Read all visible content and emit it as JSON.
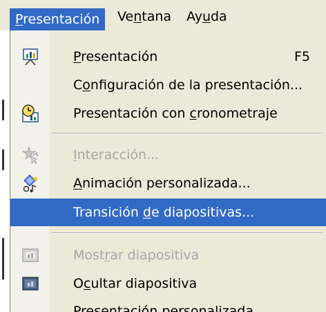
{
  "menubar": {
    "items": [
      {
        "pre": "",
        "u": "P",
        "post": "resentación"
      },
      {
        "pre": "Ve",
        "u": "n",
        "post": "tana"
      },
      {
        "pre": "Ay",
        "u": "u",
        "post": "da"
      }
    ]
  },
  "menu": {
    "items": [
      {
        "pre": "",
        "u": "P",
        "post": "resentación",
        "shortcut": "F5",
        "icon": "slideshow-screen-icon"
      },
      {
        "pre": "C",
        "u": "o",
        "post": "nfiguración de la presentación..."
      },
      {
        "pre": "Presentación con ",
        "u": "c",
        "post": "ronometraje",
        "icon": "rehearse-timings-icon"
      },
      {
        "pre": "",
        "u": "I",
        "post": "nteracción...",
        "icon": "interaction-star-icon"
      },
      {
        "pre": "",
        "u": "A",
        "post": "nimación personalizada...",
        "icon": "custom-animation-icon"
      },
      {
        "pre": "Transición ",
        "u": "d",
        "post": "e diapositivas..."
      },
      {
        "pre": "Most",
        "u": "r",
        "post": "ar diapositiva",
        "icon": "show-slide-icon"
      },
      {
        "pre": "O",
        "u": "c",
        "post": "ultar diapositiva",
        "icon": "hide-slide-icon"
      },
      {
        "pre": "",
        "u": "P",
        "post": "resentación personalizada..."
      }
    ]
  },
  "colors": {
    "highlight": "#316ac5",
    "menu_bg": "#ece9d8",
    "disabled_text": "#a7a6aa"
  }
}
